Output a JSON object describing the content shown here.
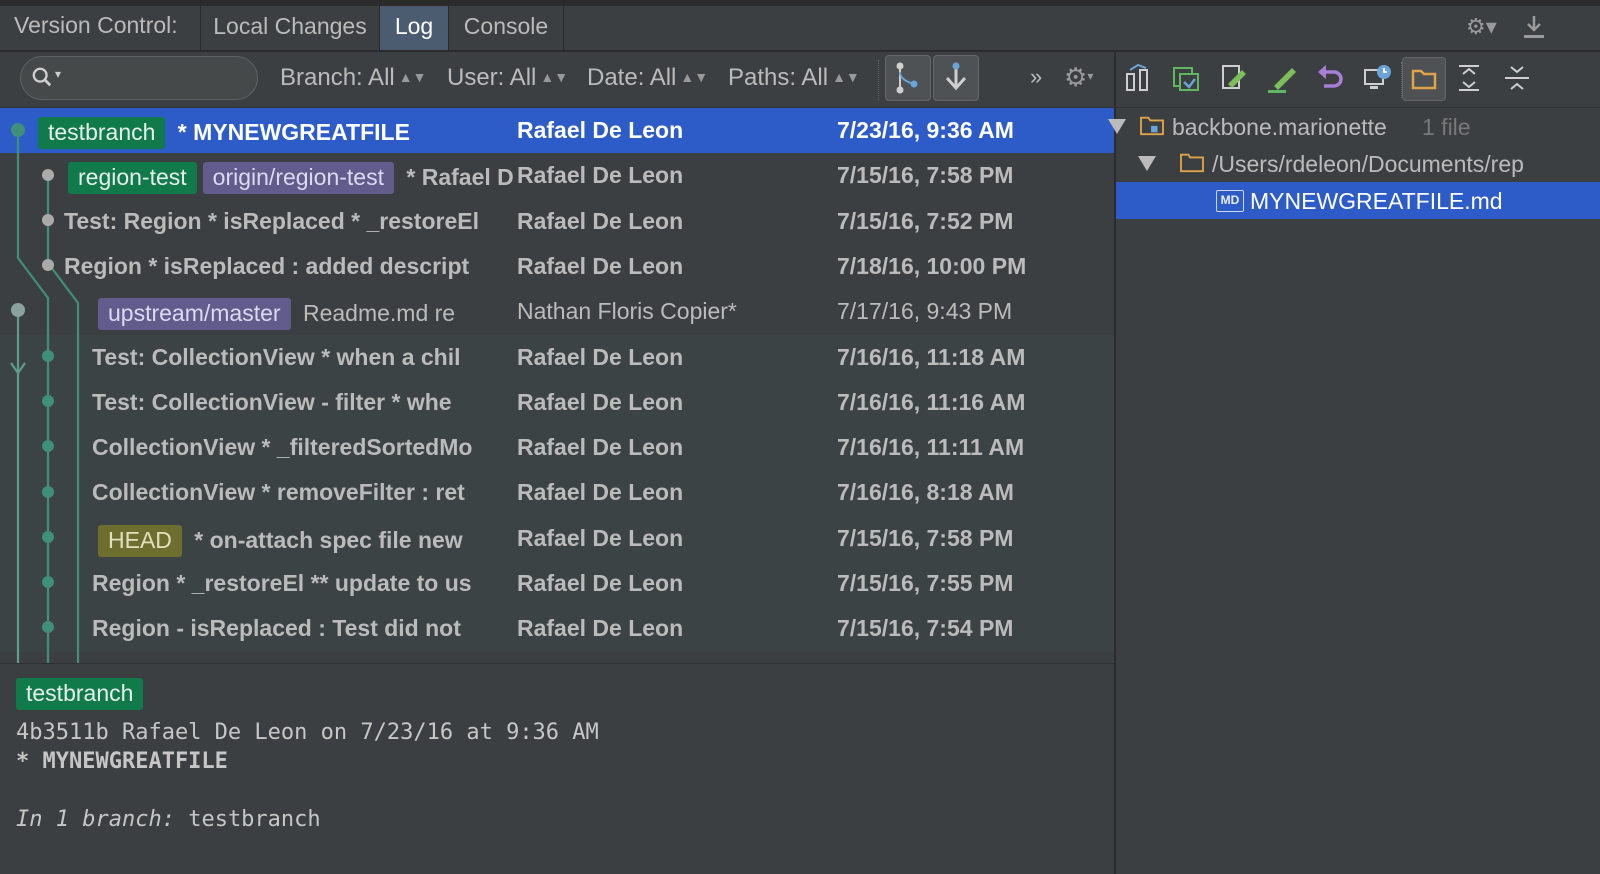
{
  "header": {
    "label": "Version Control:",
    "tabs": [
      {
        "label": "Local Changes",
        "active": false
      },
      {
        "label": "Log",
        "active": true
      },
      {
        "label": "Console",
        "active": false
      }
    ],
    "right_icons": [
      "settings-gear-icon",
      "hide-panel-icon"
    ]
  },
  "toolbar": {
    "search": {
      "value": "",
      "placeholder": ""
    },
    "filters": [
      {
        "label": "Branch: All"
      },
      {
        "label": "User: All"
      },
      {
        "label": "Date: All"
      },
      {
        "label": "Paths: All"
      }
    ],
    "icons": [
      "collapse-linear-branches-icon",
      "go-to-commit-icon",
      "more-chevron-icon",
      "settings-gear-icon"
    ]
  },
  "commits": [
    {
      "refs": [
        {
          "name": "testbranch",
          "color": "green"
        }
      ],
      "subject": "* MYNEWGREATFILE",
      "author": "Rafael De Leon",
      "date": "7/23/16, 9:36 AM",
      "selected": true
    },
    {
      "refs": [
        {
          "name": "region-test",
          "color": "green"
        },
        {
          "name": "origin/region-test",
          "color": "purple"
        }
      ],
      "subject": "* Rafael De Leon",
      "author": "Rafael De Leon",
      "date": "7/15/16, 7:58 PM"
    },
    {
      "refs": [],
      "subject": "Test: Region * isReplaced * _restoreEl",
      "author": "Rafael De Leon",
      "date": "7/15/16, 7:52 PM"
    },
    {
      "refs": [],
      "subject": "Region * isReplaced : added descript",
      "author": "Rafael De Leon",
      "date": "7/18/16, 10:00 PM"
    },
    {
      "refs": [
        {
          "name": "upstream/master",
          "color": "purple"
        }
      ],
      "subject": "Readme.md re",
      "author": "Nathan Floris Copier*",
      "date": "7/17/16, 9:43 PM"
    },
    {
      "refs": [],
      "subject": "Test: CollectionView * when a chil",
      "author": "Rafael De Leon",
      "date": "7/16/16, 11:18 AM"
    },
    {
      "refs": [],
      "subject": "Test: CollectionView - filter * whe",
      "author": "Rafael De Leon",
      "date": "7/16/16, 11:16 AM"
    },
    {
      "refs": [],
      "subject": "CollectionView * _filteredSortedMo",
      "author": "Rafael De Leon",
      "date": "7/16/16, 11:11 AM"
    },
    {
      "refs": [],
      "subject": "CollectionView * removeFilter : ret",
      "author": "Rafael De Leon",
      "date": "7/16/16, 8:18 AM"
    },
    {
      "refs": [
        {
          "name": "HEAD",
          "color": "olive"
        }
      ],
      "subject": "* on-attach spec file new",
      "author": "Rafael De Leon",
      "date": "7/15/16, 7:58 PM"
    },
    {
      "refs": [],
      "subject": "Region * _restoreEl ** update to us",
      "author": "Rafael De Leon",
      "date": "7/15/16, 7:55 PM"
    },
    {
      "refs": [],
      "subject": "Region - isReplaced : Test did not",
      "author": "Rafael De Leon",
      "date": "7/15/16, 7:54 PM"
    }
  ],
  "details": {
    "branch": "testbranch",
    "meta": "4b3511b Rafael De Leon on 7/23/16 at 9:36 AM",
    "message": "* MYNEWGREATFILE",
    "in_branch_prefix": "In 1 branch:",
    "in_branch_name": "testbranch"
  },
  "changes": {
    "toolbar_icons": [
      "show-diff-icon",
      "get-revision-icon",
      "edit-source-icon",
      "edit-commit-icon",
      "revert-icon",
      "history-icon",
      "group-by-directory-icon",
      "expand-all-icon",
      "collapse-all-icon"
    ],
    "tree": [
      {
        "label": "backbone.marionette",
        "meta": "1 file",
        "type": "module"
      },
      {
        "label": "/Users/rdeleon/Documents/rep",
        "type": "folder"
      },
      {
        "label": "MYNEWGREATFILE.md",
        "type": "file",
        "badge": "MD",
        "selected": true
      }
    ]
  },
  "colors": {
    "background": "#3c3f41",
    "selection": "#2d5cc8",
    "ref_green": "#117a4a",
    "ref_purple": "#615c8c",
    "ref_olive": "#6e6e2e",
    "graph": "#3f8f7a"
  }
}
